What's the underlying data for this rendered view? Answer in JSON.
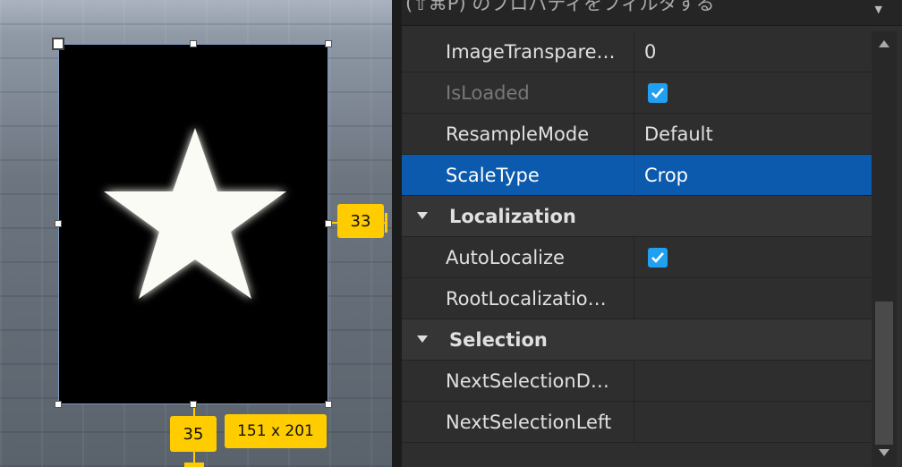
{
  "viewport": {
    "frame_size_label": "151 x 201",
    "right_offset_label": "33",
    "bottom_offset_label": "35",
    "star_icon": "star-icon"
  },
  "properties": {
    "filter_placeholder": "(⇧⌘P) のプロパティをフィルタする",
    "rows": [
      {
        "name": "ImageTranspare…",
        "value": "0"
      },
      {
        "name": "IsLoaded",
        "checked": true
      },
      {
        "name": "ResampleMode",
        "value": "Default"
      },
      {
        "name": "ScaleType",
        "value": "Crop"
      },
      {
        "section": "Localization"
      },
      {
        "name": "AutoLocalize",
        "checked": true
      },
      {
        "name": "RootLocalizatio…",
        "value": ""
      },
      {
        "section": "Selection"
      },
      {
        "name": "NextSelectionD…",
        "value": ""
      },
      {
        "name": "NextSelectionLeft",
        "value": ""
      }
    ]
  },
  "colors": {
    "selection": "#0b5aad",
    "checkbox": "#21a0f2",
    "measure_tag": "#ffcc00"
  }
}
